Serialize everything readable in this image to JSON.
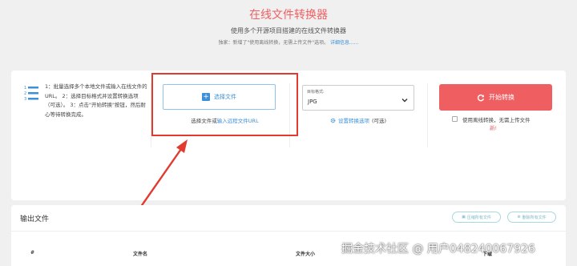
{
  "header": {
    "title": "在线文件转换器",
    "subtitle": "使用多个开源项目搭建的在线文件转换器",
    "notice": "独家：新增了\"使用离线转换，无需上传文件\"选项。",
    "notice_link": "详细信息......"
  },
  "steps": {
    "icon": "list-numbered-icon",
    "text": "1：批量选择多个本地文件或输入在线文件的URL。 2：选择目标格式并设置转换选项（可选）。 3：点击\"开始转换\"按钮，然后耐心等待转换完成。"
  },
  "upload": {
    "button_label": "选择文件",
    "or_text": "选择文件或",
    "url_link": "输入远程文件URL"
  },
  "format": {
    "label": "目标格式:",
    "value": "JPG",
    "settings_link": "设置转换选项",
    "settings_suffix": "(可选)"
  },
  "convert": {
    "button_label": "开始转换",
    "offline_label": "使用离线转换，无需上传文件",
    "offline_badge": "新!"
  },
  "output": {
    "title": "输出文件",
    "compress_all": "压缩所有文件",
    "delete_all": "删除所有文件",
    "columns": [
      "#",
      "文件名",
      "文件大小",
      "下载"
    ]
  },
  "watermark": "掘金技术社区 @ 用户048240067926",
  "colors": {
    "accent": "#ef5f62",
    "link": "#3d8fd6",
    "highlight": "#e23a2e"
  }
}
